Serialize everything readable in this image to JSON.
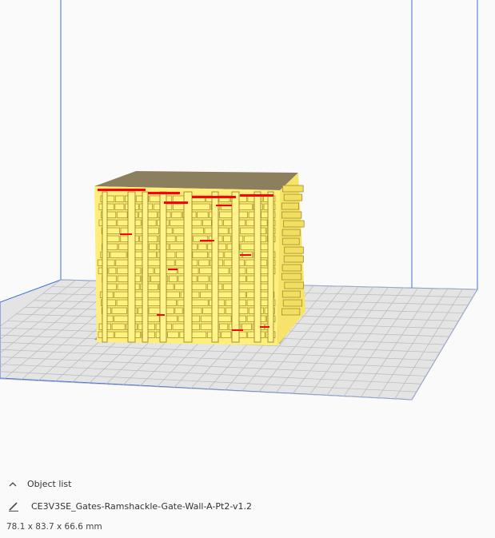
{
  "object_panel": {
    "header_label": "Object list",
    "object_name": "CE3V3SE_Gates-Ramshackle-Gate-Wall-A-Pt2-v1.2",
    "dimensions": "78.1 x 83.7 x 66.6 mm"
  },
  "icons": {
    "collapse": "chevron-up-icon",
    "edit": "pencil-icon"
  },
  "colors": {
    "background": "#fafafa",
    "build_volume_edge": "#3d6dd6",
    "build_plate": "#dcdcdc",
    "grid_line": "#b9b9b9",
    "model_yellow": "#ffef7a",
    "model_shade": "#d8c44a",
    "model_shadow": "#8c7f60",
    "overhang_red": "#ff0000"
  }
}
